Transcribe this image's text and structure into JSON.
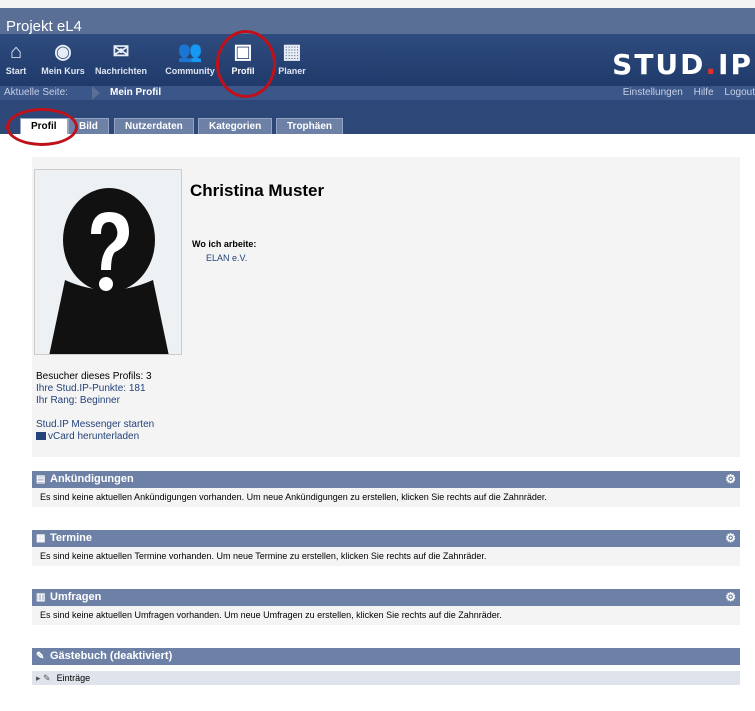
{
  "header": {
    "project_title": "Projekt eL4"
  },
  "nav": {
    "items": [
      {
        "label": "Start",
        "icon": "home-icon",
        "glyph": "⌂"
      },
      {
        "label": "Mein Kurs",
        "icon": "course-icon",
        "glyph": "◉"
      },
      {
        "label": "Nachrichten",
        "icon": "mail-icon",
        "glyph": "✉"
      },
      {
        "label": "Community",
        "icon": "community-icon",
        "glyph": "👥"
      },
      {
        "label": "Profil",
        "icon": "profile-icon",
        "glyph": "▣"
      },
      {
        "label": "Planer",
        "icon": "calendar-icon",
        "glyph": "▦"
      }
    ],
    "brand_main": "STUD",
    "brand_dot": ".",
    "brand_end": "IP"
  },
  "breadcrumb": {
    "label": "Aktuelle Seite:",
    "current": "Mein Profil",
    "right": [
      "Einstellungen",
      "Hilfe",
      "Logout"
    ]
  },
  "tabs": [
    "Profil",
    "Bild",
    "Nutzerdaten",
    "Kategorien",
    "Trophäen"
  ],
  "profile": {
    "name": "Christina Muster",
    "work_label": "Wo ich arbeite:",
    "work_value": "ELAN e.V.",
    "visitors": "Besucher dieses Profils: 3",
    "points": "Ihre Stud.IP-Punkte: 181",
    "rank": "Ihr Rang: Beginner",
    "messenger": "Stud.IP Messenger starten",
    "vcard": "vCard herunterladen"
  },
  "sections": [
    {
      "title": "Ankündigungen",
      "body": "Es sind keine aktuellen Ankündigungen vorhanden. Um neue Ankündigungen zu erstellen, klicken Sie rechts auf die Zahnräder."
    },
    {
      "title": "Termine",
      "body": "Es sind keine aktuellen Termine vorhanden. Um neue Termine zu erstellen, klicken Sie rechts auf die Zahnräder."
    },
    {
      "title": "Umfragen",
      "body": "Es sind keine aktuellen Umfragen vorhanden. Um neue Umfragen zu erstellen, klicken Sie rechts auf die Zahnräder."
    },
    {
      "title": "Gästebuch (deaktiviert)",
      "body": "Einträge"
    }
  ],
  "colors": {
    "accent": "#6d81a6",
    "nav_bg": "#2f4c7e",
    "highlight": "#c0111a"
  }
}
